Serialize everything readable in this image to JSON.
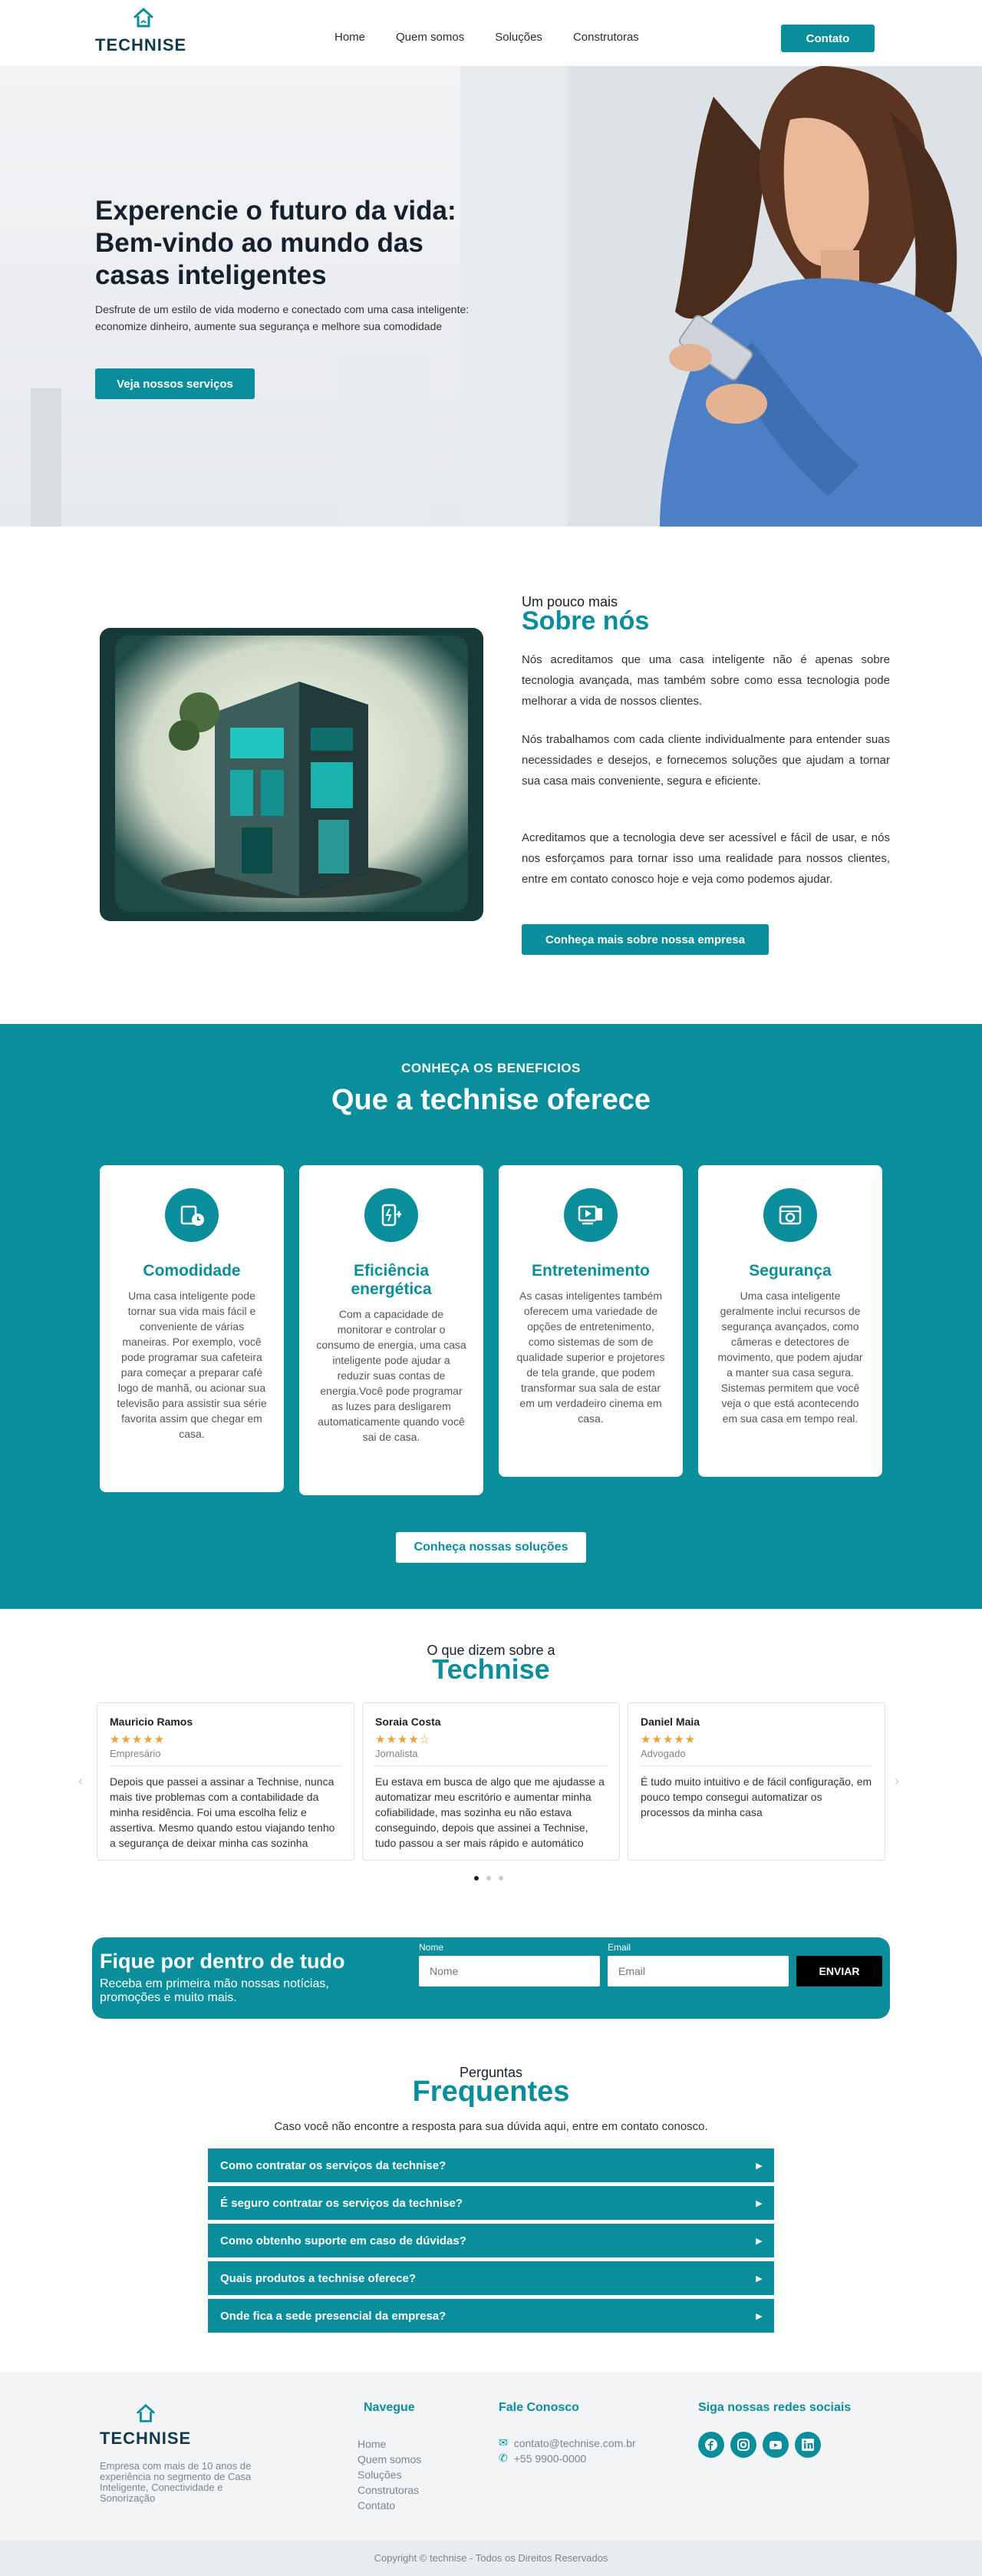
{
  "brand": {
    "name": "TECHNISE",
    "accent": "#0a8e9c"
  },
  "nav": {
    "items": [
      "Home",
      "Quem somos",
      "Soluções",
      "Construtoras"
    ],
    "contact_label": "Contato"
  },
  "hero": {
    "title": "Experencie o futuro da vida: Bem-vindo ao mundo das casas inteligentes",
    "text": "Desfrute de um estilo de vida moderno e conectado com uma casa inteligente: economize dinheiro, aumente sua segurança e melhore sua comodidade",
    "button": "Veja nossos serviços"
  },
  "about": {
    "kicker": "Um pouco mais",
    "title": "Sobre nós",
    "paragraphs": [
      "Nós acreditamos que uma casa inteligente não é apenas sobre tecnologia avançada, mas também sobre como essa tecnologia pode melhorar a vida de nossos clientes.",
      "Nós trabalhamos com cada cliente individualmente para entender suas necessidades e desejos, e fornecemos soluções que ajudam a tornar sua casa mais conveniente, segura e eficiente.",
      "Acreditamos que a tecnologia deve ser acessível e fácil de usar, e nós nos esforçamos para tornar isso uma realidade para nossos clientes, entre em contato conosco hoje e veja como podemos ajudar."
    ],
    "button": "Conheça mais sobre nossa empresa"
  },
  "benefits": {
    "kicker": "CONHEÇA OS BENEFICIOS",
    "title": "Que a technise oferece",
    "cards": [
      {
        "icon": "hand-home-icon",
        "title": "Comodidade",
        "text": "Uma casa inteligente pode tornar sua vida mais fácil e conveniente de várias maneiras. Por exemplo, você pode programar sua cafeteira para começar a preparar café logo de manhã, ou acionar sua televisão para assistir sua série favorita assim que chegar em casa."
      },
      {
        "icon": "energy-plug-icon",
        "title": "Eficiência energética",
        "text": "Com a capacidade de monitorar e controlar o consumo de energia, uma casa inteligente pode ajudar a reduzir suas contas de energia.Você pode programar as luzes para desligarem automaticamente quando você sai de casa."
      },
      {
        "icon": "media-icon",
        "title": "Entretenimento",
        "text": "As casas inteligentes também oferecem uma variedade de opções de entretenimento, como sistemas de som de qualidade superior e projetores de tela grande, que podem transformar sua sala de estar em um verdadeiro cinema em casa."
      },
      {
        "icon": "camera-lock-icon",
        "title": "Segurança",
        "text": "Uma casa inteligente geralmente inclui recursos de segurança avançados, como câmeras e detectores de movimento, que podem ajudar a manter sua casa segura. Sistemas permitem que você veja o que está acontecendo em sua casa em tempo real."
      }
    ],
    "button": "Conheça nossas soluções"
  },
  "testimonials": {
    "kicker": "O que dizem sobre a",
    "title": "Technise",
    "items": [
      {
        "name": "Mauricio Ramos",
        "stars": 5,
        "role": "Empresário",
        "text": "Depois que passei a assinar a Technise, nunca mais tive problemas com a contabilidade da minha residência. Foi uma escolha feliz e assertiva. Mesmo quando estou viajando tenho a segurança de deixar minha cas sozinha"
      },
      {
        "name": "Soraia Costa",
        "stars": 4.5,
        "role": "Jornalista",
        "text": "Eu estava em busca de algo que me ajudasse a automatizar meu escritório e aumentar minha cofiabilidade, mas sozinha eu não estava conseguindo, depois que assinei a Technise, tudo passou a ser mais rápido e automático"
      },
      {
        "name": "Daniel Maia",
        "stars": 5,
        "role": "Advogado",
        "text": "É tudo muito intuitivo e de fácil configuração, em pouco tempo consegui automatizar os processos da minha casa"
      }
    ],
    "stars_5": "★★★★★",
    "stars_45": "★★★★☆"
  },
  "newsletter": {
    "title": "Fique por dentro de tudo",
    "subtitle": "Receba em primeira mão nossas notícias, promoções e muito mais.",
    "name_label": "Nome",
    "name_placeholder": "Nome",
    "email_label": "Email",
    "email_placeholder": "Email",
    "send": "ENVIAR"
  },
  "faq": {
    "kicker": "Perguntas",
    "title": "Frequentes",
    "subtitle": "Caso você não encontre a resposta para sua dúvida aqui, entre em contato conosco.",
    "items": [
      "Como contratar os serviços da technise?",
      "É seguro contratar os serviços da technise?",
      "Como obtenho suporte em caso de dúvidas?",
      "Quais produtos a technise oferece?",
      "Onde fica a sede presencial da empresa?"
    ]
  },
  "footer": {
    "description": "Empresa com mais de 10 anos de experiência no segmento de Casa Inteligente, Conectividade e Sonorização",
    "nav_title": "Navegue",
    "nav_items": [
      "Home",
      "Quem somos",
      "Soluções",
      "Construtoras",
      "Contato"
    ],
    "contact_title": "Fale Conosco",
    "email": "contato@technise.com.br",
    "phone": "+55 9900-0000",
    "social_title": "Siga nossas redes sociais",
    "socials": [
      "facebook-icon",
      "instagram-icon",
      "youtube-icon",
      "linkedin-icon"
    ],
    "copyright": "Copyright © technise - Todos os Direitos Reservados"
  }
}
